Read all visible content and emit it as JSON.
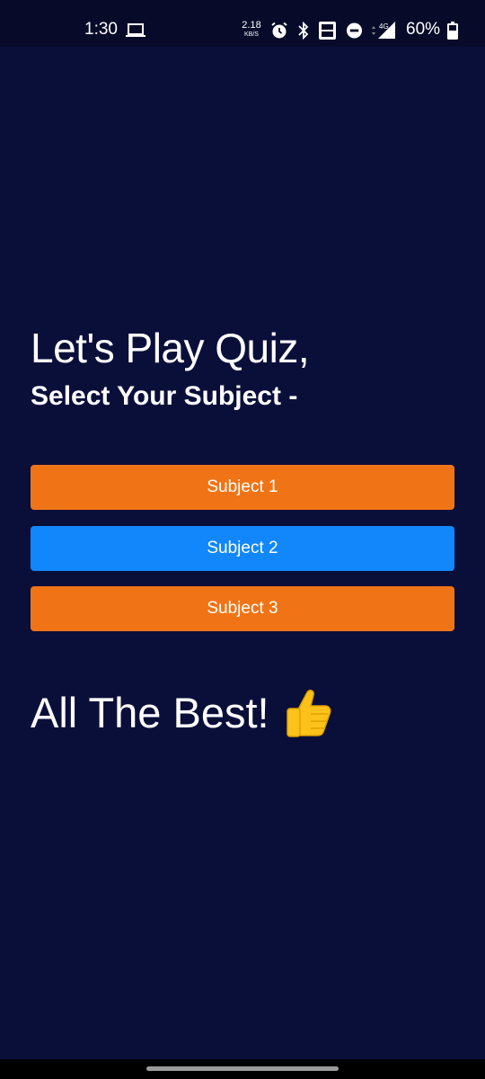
{
  "status_bar": {
    "time": "1:30",
    "speed_value": "2.18",
    "speed_unit": "KB/S",
    "network": "4G",
    "battery": "60%"
  },
  "main": {
    "title": "Let's Play Quiz,",
    "subtitle": "Select Your Subject -",
    "subjects": [
      {
        "label": "Subject 1",
        "color": "#f07416"
      },
      {
        "label": "Subject 2",
        "color": "#1187fb"
      },
      {
        "label": "Subject 3",
        "color": "#f07416"
      }
    ],
    "footer": "All The Best!",
    "footer_icon": "thumbs-up-icon"
  },
  "colors": {
    "background": "#0a0f3a",
    "status_bar": "#070b29"
  }
}
